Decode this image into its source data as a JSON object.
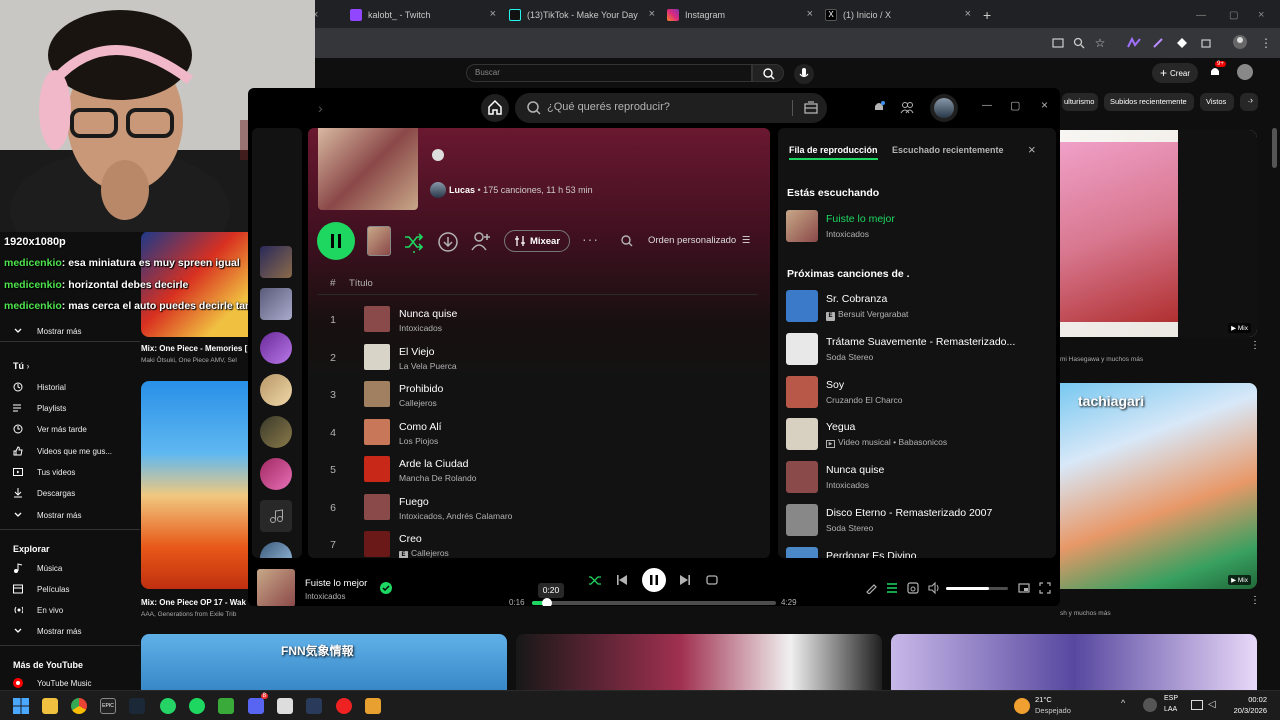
{
  "browser": {
    "tabs": [
      {
        "label": "kalobt_ - Twitch",
        "icon": "twitch-icon",
        "color": "#9146ff"
      },
      {
        "label": "(13)TikTok - Make Your Day",
        "icon": "tiktok-icon",
        "color": "#111111"
      },
      {
        "label": "Instagram",
        "icon": "instagram-icon",
        "color": "#e1306c"
      },
      {
        "label": "(1) Inicio / X",
        "icon": "x-icon",
        "color": "#000000"
      }
    ]
  },
  "youtube": {
    "search_placeholder": "Buscar",
    "create_label": "Crear",
    "notif_count": "9+",
    "chips": [
      "ulturismo",
      "Subidos recientemente",
      "Vistos"
    ],
    "sidebar_top": [
      {
        "label": "Mostrar más",
        "icon": "chevron-down-icon"
      }
    ],
    "tu_header": "Tú",
    "tu_items": [
      {
        "label": "Historial",
        "icon": "history-icon"
      },
      {
        "label": "Playlists",
        "icon": "playlist-icon"
      },
      {
        "label": "Ver más tarde",
        "icon": "clock-icon"
      },
      {
        "label": "Videos que me gus...",
        "icon": "like-icon"
      },
      {
        "label": "Tus videos",
        "icon": "video-icon"
      },
      {
        "label": "Descargas",
        "icon": "download-icon"
      },
      {
        "label": "Mostrar más",
        "icon": "chevron-down-icon"
      }
    ],
    "explorar_header": "Explorar",
    "explorar_items": [
      {
        "label": "Música",
        "icon": "music-icon"
      },
      {
        "label": "Películas",
        "icon": "film-icon"
      },
      {
        "label": "En vivo",
        "icon": "live-icon"
      },
      {
        "label": "Mostrar más",
        "icon": "chevron-down-icon"
      }
    ],
    "mas_header": "Más de YouTube",
    "mas_items": [
      {
        "label": "YouTube Music",
        "icon": "yt-music-icon"
      }
    ],
    "video1": {
      "title": "Mix: One Piece - Memories [",
      "channel": "Maki Ōtsuki, One Piece AMV, Sel"
    },
    "video2": {
      "title": "Mix: One Piece OP 17 - Wak",
      "channel": "AAA, Generations from Exile Trib"
    },
    "video_right1_channel": "mi Hasegawa y muchos más",
    "video_right2_channel": "sh y muchos más",
    "mix_badge": "Mix",
    "thumb_caption": "tachiagari",
    "thumb_caption2": "FNN気象情報"
  },
  "stream": {
    "resolution": "1920x1080p",
    "chat": [
      {
        "user": "medicenkio",
        "msg": ": esa miniatura es muy spreen igual"
      },
      {
        "user": "medicenkio",
        "msg": ": horizontal debes decirle"
      },
      {
        "user": "medicenkio",
        "msg": ": mas cerca el auto puedes decirle tambien a la ia"
      }
    ]
  },
  "spotify": {
    "search_placeholder": "¿Qué querés reproducir?",
    "playlist": {
      "owner": "Lucas",
      "meta": "• 175 canciones, 11 h 53 min",
      "mix_label": "Mixear",
      "sort_label": "Orden personalizado",
      "col_num": "#",
      "col_title": "Título"
    },
    "tracks": [
      {
        "n": "1",
        "title": "Nunca quise",
        "artist": "Intoxicados",
        "explicit": false,
        "color": "#8a4a4a"
      },
      {
        "n": "2",
        "title": "El Viejo",
        "artist": "La Vela Puerca",
        "explicit": false,
        "color": "#d8d4c8"
      },
      {
        "n": "3",
        "title": "Prohibido",
        "artist": "Callejeros",
        "explicit": false,
        "color": "#a08060"
      },
      {
        "n": "4",
        "title": "Como Alí",
        "artist": "Los Piojos",
        "explicit": false,
        "color": "#c87858"
      },
      {
        "n": "5",
        "title": "Arde la Ciudad",
        "artist": "Mancha De Rolando",
        "explicit": false,
        "color": "#c82818"
      },
      {
        "n": "6",
        "title": "Fuego",
        "artist": "Intoxicados, Andrés Calamaro",
        "explicit": false,
        "color": "#8a4a4a"
      },
      {
        "n": "7",
        "title": "Creo",
        "artist": "Callejeros",
        "explicit": true,
        "color": "#6a1818"
      }
    ],
    "queue": {
      "tab_active": "Fila de reproducción",
      "tab_other": "Escuchado recientemente",
      "now_header": "Estás escuchando",
      "now": {
        "title": "Fuiste lo mejor",
        "artist": "Intoxicados",
        "color": "#8a4a4a"
      },
      "next_header": "Próximas canciones de .",
      "items": [
        {
          "title": "Sr. Cobranza",
          "artist": "Bersuit Vergarabat",
          "badge": "E",
          "color": "#3a7ac8"
        },
        {
          "title": "Trátame Suavemente - Remasterizado...",
          "artist": "Soda Stereo",
          "badge": "",
          "color": "#e8e8e8"
        },
        {
          "title": "Soy",
          "artist": "Cruzando El Charco",
          "badge": "",
          "color": "#b85848"
        },
        {
          "title": "Yegua",
          "artist": "Video musical • Babasonicos",
          "badge": "video",
          "color": "#d8d0c0"
        },
        {
          "title": "Nunca quise",
          "artist": "Intoxicados",
          "badge": "",
          "color": "#8a4a4a"
        },
        {
          "title": "Disco Eterno - Remasterizado 2007",
          "artist": "Soda Stereo",
          "badge": "",
          "color": "#888888"
        },
        {
          "title": "Perdonar Es Divino",
          "artist": "",
          "badge": "",
          "color": "#4a88c8"
        }
      ]
    },
    "player": {
      "title": "Fuiste lo mejor",
      "artist": "Intoxicados",
      "elapsed": "0:16",
      "tooltip": "0:20",
      "total": "4:29",
      "progress": 0.06,
      "volume": 0.7,
      "accent": "#1ed760"
    }
  },
  "taskbar": {
    "weather_temp": "21°C",
    "weather_desc": "Despejado",
    "lang1": "ESP",
    "lang2": "LAA",
    "time": "00:02",
    "date": "20/3/2026",
    "discord_badge": "8"
  }
}
